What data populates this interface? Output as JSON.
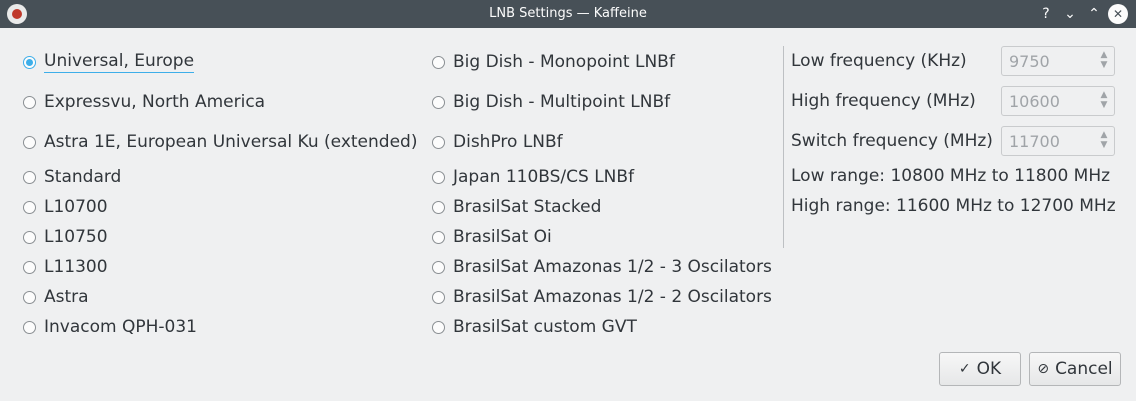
{
  "window": {
    "title": "LNB Settings — Kaffeine",
    "help_icon": "help-icon",
    "minimize_icon": "chevron-down-icon",
    "maximize_icon": "chevron-up-icon",
    "close_icon": "close-icon"
  },
  "lnb_types": {
    "col1": [
      {
        "label": "Universal, Europe",
        "checked": true
      },
      {
        "label": "Expressvu, North America",
        "checked": false
      },
      {
        "label": "Astra 1E, European Universal Ku (extended)",
        "checked": false
      },
      {
        "label": "Standard",
        "checked": false
      },
      {
        "label": "L10700",
        "checked": false
      },
      {
        "label": "L10750",
        "checked": false
      },
      {
        "label": "L11300",
        "checked": false
      },
      {
        "label": "Astra",
        "checked": false
      },
      {
        "label": "Invacom QPH-031",
        "checked": false
      }
    ],
    "col2": [
      {
        "label": "Big Dish - Monopoint LNBf",
        "checked": false
      },
      {
        "label": "Big Dish - Multipoint LNBf",
        "checked": false
      },
      {
        "label": "DishPro LNBf",
        "checked": false
      },
      {
        "label": "Japan 110BS/CS LNBf",
        "checked": false
      },
      {
        "label": "BrasilSat Stacked",
        "checked": false
      },
      {
        "label": "BrasilSat Oi",
        "checked": false
      },
      {
        "label": "BrasilSat Amazonas 1/2 - 3 Oscilators",
        "checked": false
      },
      {
        "label": "BrasilSat Amazonas 1/2 - 2 Oscilators",
        "checked": false
      },
      {
        "label": "BrasilSat custom GVT",
        "checked": false
      }
    ]
  },
  "frequencies": {
    "low": {
      "label": "Low frequency (KHz)",
      "value": "9750"
    },
    "high": {
      "label": "High frequency (MHz)",
      "value": "10600"
    },
    "switch": {
      "label": "Switch frequency (MHz)",
      "value": "11700"
    },
    "low_range": "Low range: 10800 MHz to 11800 MHz",
    "high_range": "High range: 11600 MHz to 12700 MHz"
  },
  "buttons": {
    "ok": "OK",
    "cancel": "Cancel"
  }
}
